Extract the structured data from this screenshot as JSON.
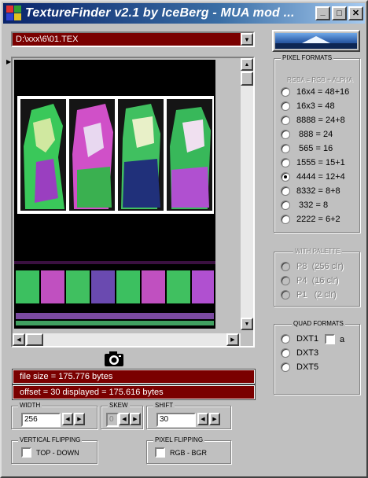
{
  "window": {
    "title": "TextureFinder v2.1 by IceBerg - MUA mod ...",
    "minimize_label": "_",
    "maximize_label": "□",
    "close_label": "✕"
  },
  "path_select": {
    "value": "D:\\xxx\\6\\01.TEX"
  },
  "pixel_formats": {
    "label": "PIXEL FORMATS",
    "subtitle": "RGBA = RGB + ALPHA",
    "options": [
      {
        "label": "16x4 = 48+16",
        "checked": false
      },
      {
        "label": "16x3 = 48",
        "checked": false
      },
      {
        "label": "8888 = 24+8",
        "checked": false
      },
      {
        "label": " 888 = 24",
        "checked": false
      },
      {
        "label": " 565 = 16",
        "checked": false
      },
      {
        "label": "1555 = 15+1",
        "checked": false
      },
      {
        "label": "4444 = 12+4",
        "checked": true
      },
      {
        "label": "8332 = 8+8",
        "checked": false
      },
      {
        "label": " 332 = 8",
        "checked": false
      },
      {
        "label": "2222 = 6+2",
        "checked": false
      }
    ]
  },
  "palette": {
    "label": "WITH PALETTE",
    "options": [
      {
        "label": "P8  (256 clr)"
      },
      {
        "label": "P4  (16 clr)"
      },
      {
        "label": "P1   (2 clr)"
      }
    ]
  },
  "quad_formats": {
    "label": "QUAD FORMATS",
    "options": [
      {
        "label": "DXT1"
      },
      {
        "label": "DXT3"
      },
      {
        "label": "DXT5"
      }
    ],
    "alpha_label": "a"
  },
  "info": {
    "file_size": "file size = 175.776 bytes",
    "offset_line": "offset = 30   displayed = 175.616 bytes"
  },
  "width": {
    "label": "WIDTH",
    "value": "256"
  },
  "skew": {
    "label": "SKEW",
    "value": "0"
  },
  "shift": {
    "label": "SHIFT",
    "value": "30"
  },
  "vertical_flipping": {
    "label": "VERTICAL FLIPPING",
    "checkbox_label": "TOP - DOWN"
  },
  "pixel_flipping": {
    "label": "PIXEL FLIPPING",
    "checkbox_label": "RGB  -  BGR"
  },
  "colors": {
    "accent_dark_red": "#7a0000",
    "title_blue": "#0a246a",
    "face": "#c0c0c0"
  }
}
